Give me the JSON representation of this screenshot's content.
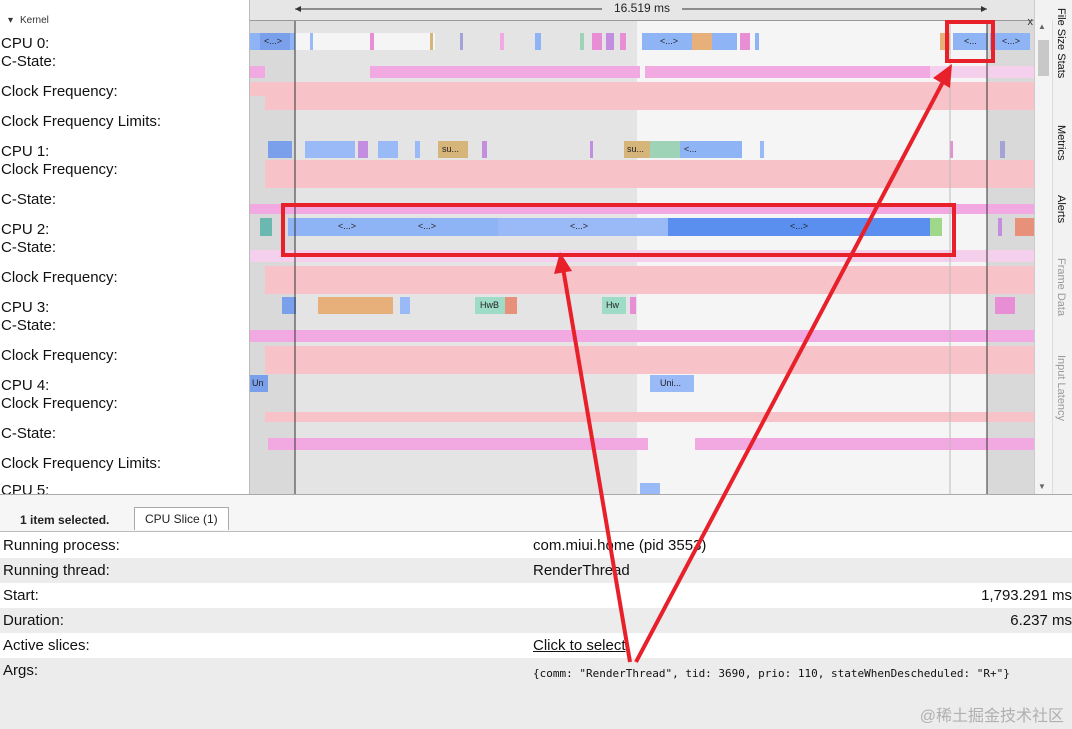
{
  "kernel_header": {
    "label": "Kernel",
    "toggle": "▾"
  },
  "timeline": {
    "range_label": "16.519 ms",
    "close": "x"
  },
  "tracks": [
    {
      "label": "CPU 0:"
    },
    {
      "label": "C-State:"
    },
    {
      "label": "Clock Frequency:"
    },
    {
      "label": "Clock Frequency Limits:"
    },
    {
      "label": "CPU 1:"
    },
    {
      "label": "Clock Frequency:"
    },
    {
      "label": "C-State:"
    },
    {
      "label": "CPU 2:"
    },
    {
      "label": "C-State:"
    },
    {
      "label": "Clock Frequency:"
    },
    {
      "label": "CPU 3:"
    },
    {
      "label": "C-State:"
    },
    {
      "label": "Clock Frequency:"
    },
    {
      "label": "CPU 4:"
    },
    {
      "label": "Clock Frequency:"
    },
    {
      "label": "C-State:"
    },
    {
      "label": "Clock Frequency Limits:"
    },
    {
      "label": "CPU 5:"
    }
  ],
  "slice_labels": {
    "cpu0_a": "<...>",
    "cpu0_b": "<...>",
    "cpu0_c": "<...",
    "cpu0_d": "<...>",
    "cpu1_a": "su...",
    "cpu1_b": "su...",
    "cpu1_c": "<...",
    "cpu2_a": "<...>",
    "cpu2_b": "<...>",
    "cpu2_c": "<...>",
    "cpu2_d": "<...>",
    "cpu3_a": "HwB",
    "cpu3_b": "Hw",
    "cpu4_a": "Un",
    "cpu4_b": "Uni..."
  },
  "side_tabs": [
    "File Size Stats",
    "Metrics",
    "Alerts",
    "Frame Data",
    "Input Latency"
  ],
  "bottom": {
    "selection": "1 item selected.",
    "tab": "CPU Slice (1)",
    "rows": [
      {
        "key": "Running process:",
        "value": "com.miui.home (pid 3553)"
      },
      {
        "key": "Running thread:",
        "value": "RenderThread"
      },
      {
        "key": "Start:",
        "value": "1,793.291 ms"
      },
      {
        "key": "Duration:",
        "value": "6.237 ms"
      },
      {
        "key": "Active slices:",
        "value": "Click to select"
      },
      {
        "key": "Args:",
        "value": "{comm: \"RenderThread\",\n tid: 3690,\n prio: 110,\n stateWhenDescheduled: \"R+\"}"
      }
    ]
  },
  "watermark": "@稀土掘金技术社区",
  "colors": {
    "annotation_red": "#e8202a",
    "cstate_pink": "#f2a8e0",
    "freq_pink": "#f7c3c8",
    "slice_blue": "#8fb4f5",
    "slice_dark_blue": "#5a8ff0"
  }
}
